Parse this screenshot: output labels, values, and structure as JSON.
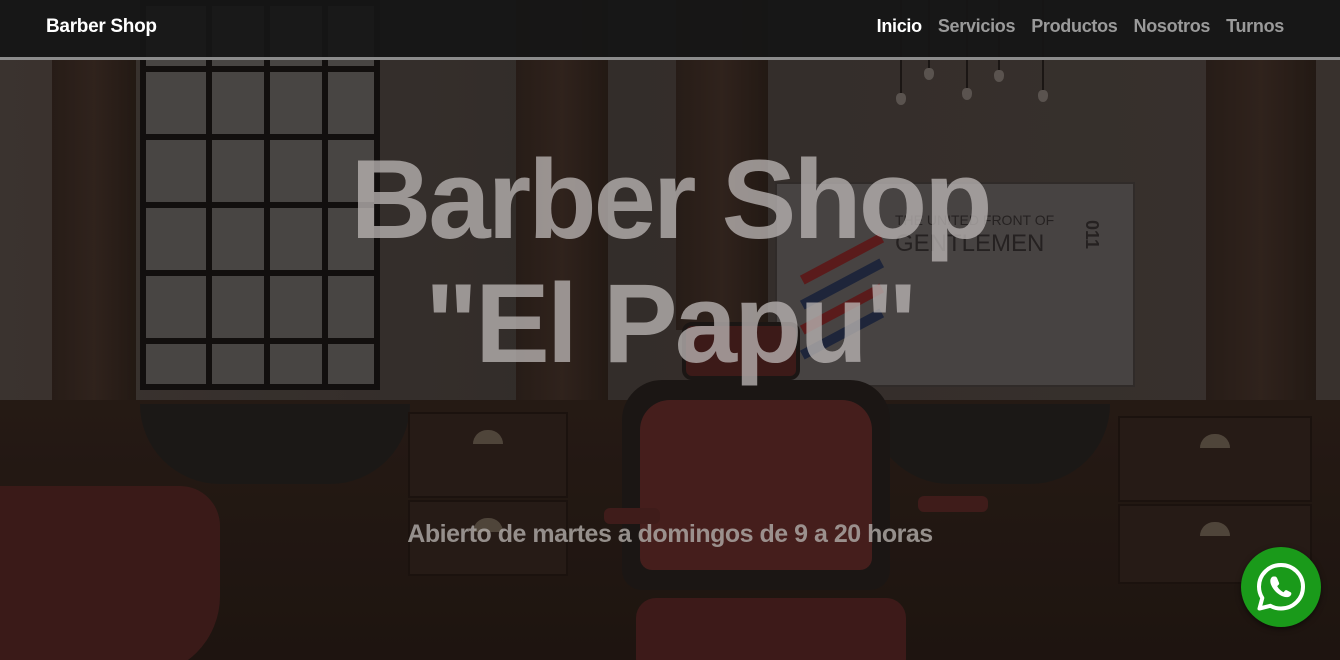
{
  "navbar": {
    "brand": "Barber Shop",
    "links": [
      {
        "label": "Inicio",
        "active": true
      },
      {
        "label": "Servicios",
        "active": false
      },
      {
        "label": "Productos",
        "active": false
      },
      {
        "label": "Nosotros",
        "active": false
      },
      {
        "label": "Turnos",
        "active": false
      }
    ]
  },
  "hero": {
    "title_line1": "Barber Shop",
    "title_line2": "\"El Papu\"",
    "subtitle": "Abierto de martes a domingos de 9 a 20 horas"
  },
  "background": {
    "poster_text_line1": "THE UNITED FRONT OF",
    "poster_text_line2": "GENTLEMEN",
    "poster_code": "011"
  },
  "floating": {
    "icon": "whatsapp-icon",
    "color": "#1a9a1a"
  },
  "colors": {
    "nav_active": "#ffffff",
    "nav_inactive": "#9a9a9a"
  }
}
